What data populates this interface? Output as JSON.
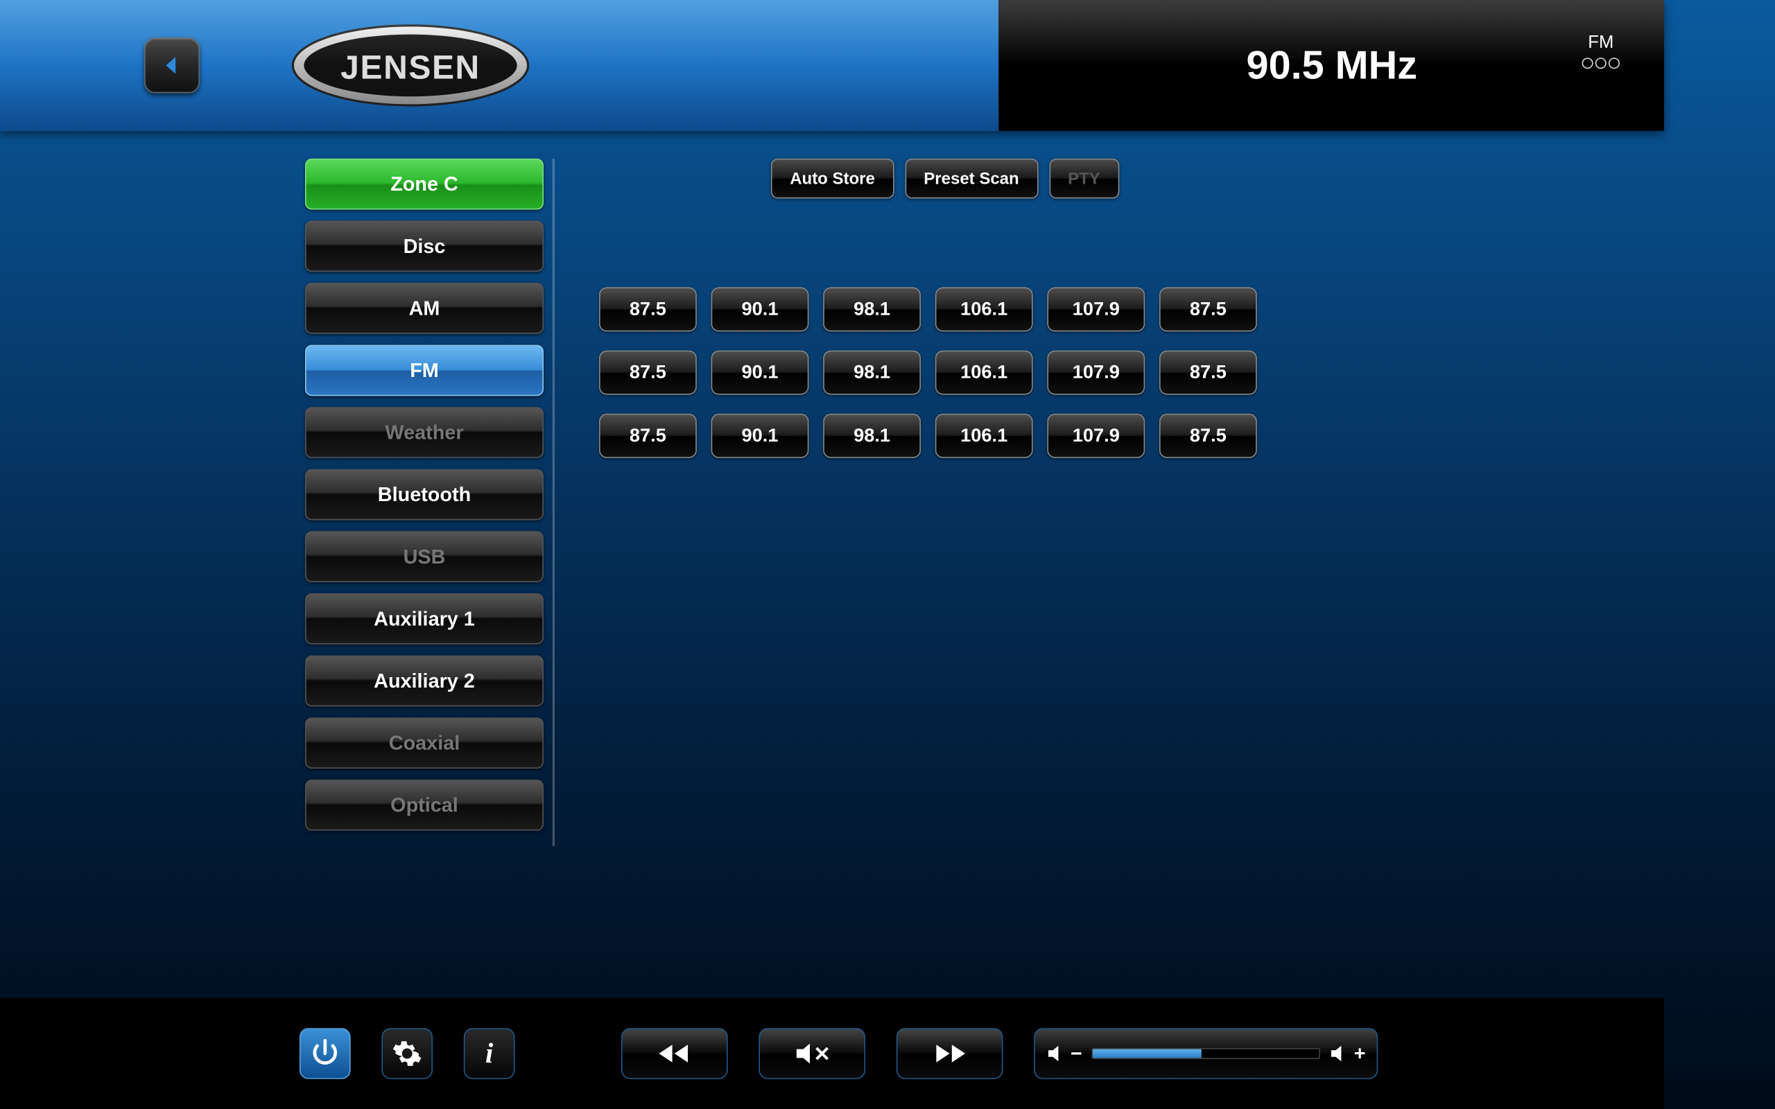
{
  "brand": "JENSEN",
  "header": {
    "frequency_display": "90.5 MHz",
    "band_label": "FM",
    "band_page_dots": 3
  },
  "sidebar": {
    "items": [
      {
        "label": "Zone C",
        "state": "zone"
      },
      {
        "label": "Disc",
        "state": "normal"
      },
      {
        "label": "AM",
        "state": "normal"
      },
      {
        "label": "FM",
        "state": "active"
      },
      {
        "label": "Weather",
        "state": "disabled"
      },
      {
        "label": "Bluetooth",
        "state": "normal"
      },
      {
        "label": "USB",
        "state": "disabled"
      },
      {
        "label": "Auxiliary 1",
        "state": "normal"
      },
      {
        "label": "Auxiliary 2",
        "state": "normal"
      },
      {
        "label": "Coaxial",
        "state": "disabled"
      },
      {
        "label": "Optical",
        "state": "disabled"
      }
    ]
  },
  "functions": [
    {
      "label": "Auto Store",
      "enabled": true
    },
    {
      "label": "Preset Scan",
      "enabled": true
    },
    {
      "label": "PTY",
      "enabled": false
    }
  ],
  "presets": [
    [
      "87.5",
      "90.1",
      "98.1",
      "106.1",
      "107.9",
      "87.5"
    ],
    [
      "87.5",
      "90.1",
      "98.1",
      "106.1",
      "107.9",
      "87.5"
    ],
    [
      "87.5",
      "90.1",
      "98.1",
      "106.1",
      "107.9",
      "87.5"
    ]
  ],
  "bottombar": {
    "power_on": true,
    "volume_percent": 48
  }
}
